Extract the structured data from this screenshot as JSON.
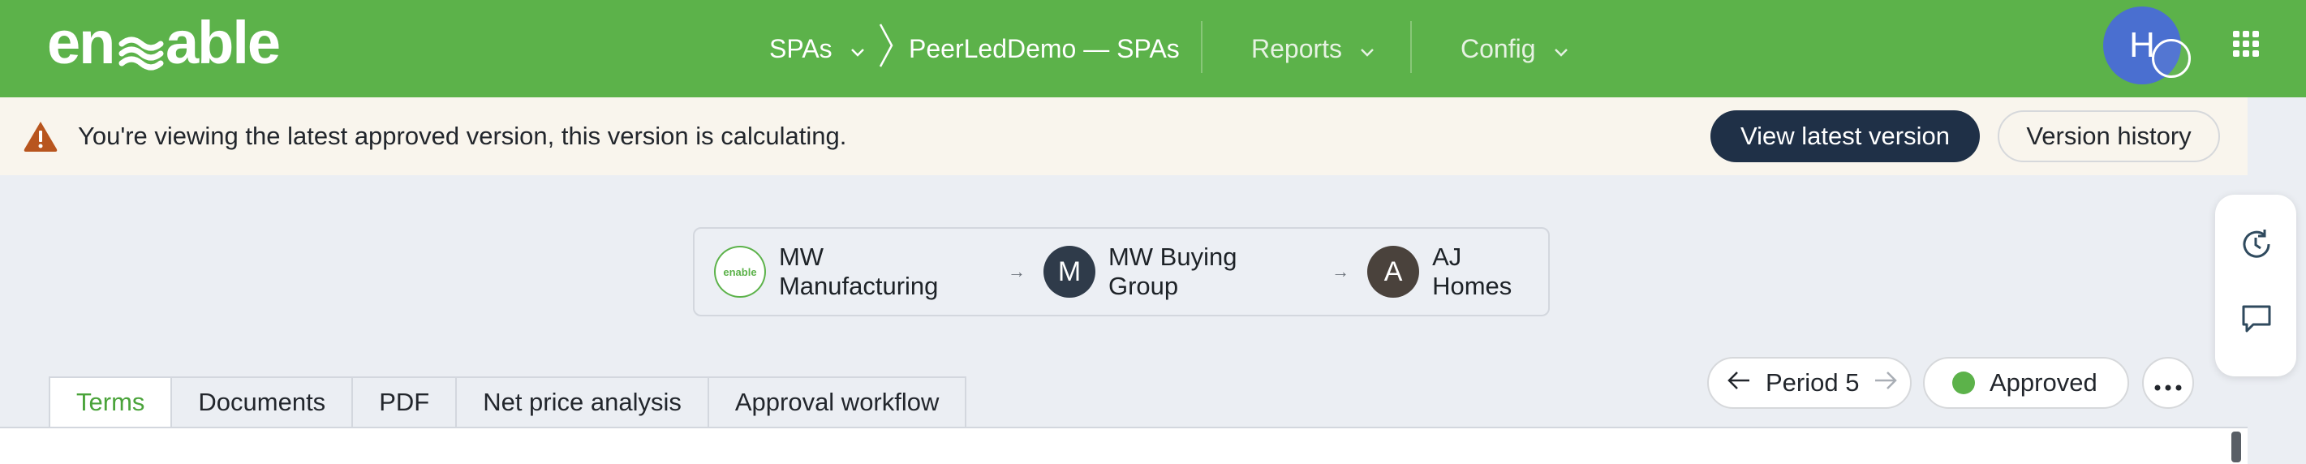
{
  "topbar": {
    "logo_text": "enable",
    "nav": {
      "spas_label": "SPAs",
      "breadcrumb_current": "PeerLedDemo — SPAs",
      "reports_label": "Reports",
      "config_label": "Config"
    },
    "user_initial": "H",
    "brand_color": "#5cb24a"
  },
  "banner": {
    "message": "You're viewing the latest approved version, this version is calculating.",
    "view_latest_label": "View latest version",
    "version_history_label": "Version history"
  },
  "chain": {
    "nodes": [
      {
        "initial": "enable",
        "label": "MW Manufacturing"
      },
      {
        "initial": "M",
        "label": "MW Buying Group",
        "color": "#2f3b4a"
      },
      {
        "initial": "A",
        "label": "AJ Homes",
        "color": "#4a423c"
      }
    ]
  },
  "tabs": [
    {
      "label": "Terms",
      "active": true
    },
    {
      "label": "Documents"
    },
    {
      "label": "PDF"
    },
    {
      "label": "Net price analysis"
    },
    {
      "label": "Approval workflow"
    }
  ],
  "period": {
    "label": "Period 5"
  },
  "status": {
    "label": "Approved",
    "color": "#5cb24a"
  },
  "icons": [
    "warning-icon",
    "chevron-down-icon",
    "chevron-right-icon",
    "apps-grid-icon",
    "arrow-left-icon",
    "arrow-right-icon",
    "more-icon",
    "history-icon",
    "comment-icon"
  ]
}
